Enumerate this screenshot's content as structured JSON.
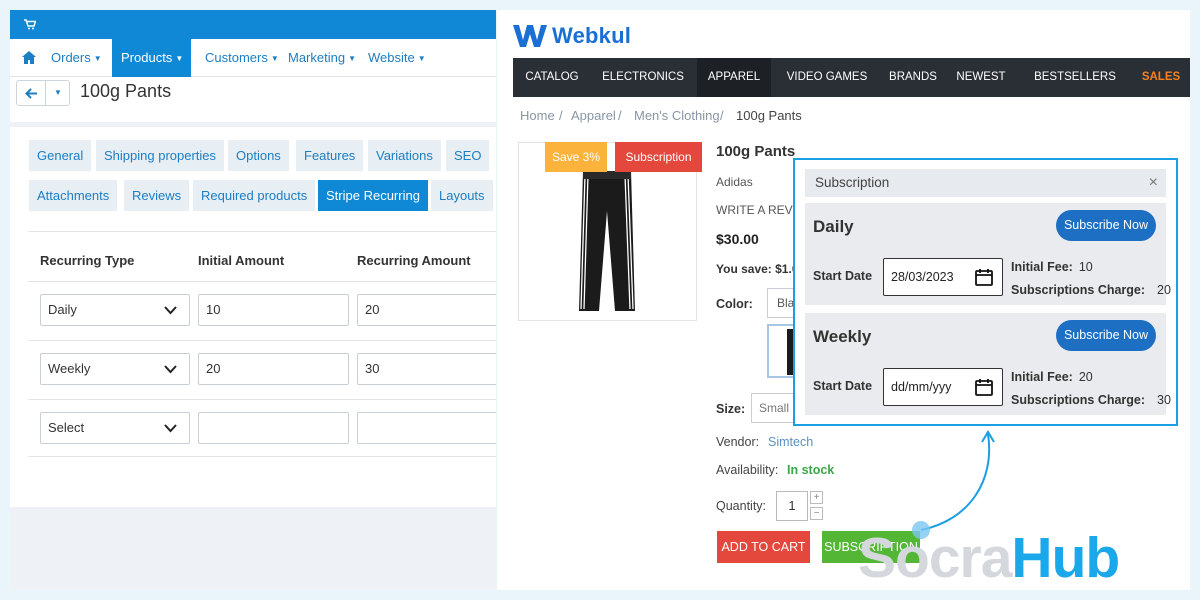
{
  "admin": {
    "menu": [
      {
        "label": "Orders",
        "active": false
      },
      {
        "label": "Products",
        "active": true
      },
      {
        "label": "Customers",
        "active": false
      },
      {
        "label": "Marketing",
        "active": false
      },
      {
        "label": "Website",
        "active": false
      }
    ],
    "page_title": "100g Pants",
    "tabs": [
      "General",
      "Shipping properties",
      "Options",
      "Features",
      "Variations",
      "SEO",
      "Attachments",
      "Reviews",
      "Required products",
      "Stripe Recurring",
      "Layouts"
    ],
    "active_tab": "Stripe Recurring",
    "table": {
      "headers": [
        "Recurring Type",
        "Initial Amount",
        "Recurring Amount"
      ],
      "rows": [
        {
          "type": "Daily",
          "initial": "10",
          "recurring": "20"
        },
        {
          "type": "Weekly",
          "initial": "20",
          "recurring": "30"
        },
        {
          "type": "Select",
          "initial": "",
          "recurring": ""
        }
      ]
    },
    "accent_color": "#0f88d5"
  },
  "store": {
    "logo": "Webkul",
    "nav": [
      "CATALOG",
      "ELECTRONICS",
      "APPAREL",
      "VIDEO GAMES",
      "BRANDS",
      "NEWEST",
      "BESTSELLERS",
      "SALES"
    ],
    "active_nav": "APPAREL",
    "breadcrumb": [
      "Home",
      "Apparel",
      "Men's Clothing",
      "100g Pants"
    ],
    "badges": {
      "save": "Save 3%",
      "subscription": "Subscription"
    },
    "product": {
      "name": "100g Pants",
      "brand": "Adidas",
      "review_link": "WRITE A REVIE",
      "price": "$30.00",
      "you_save": "You save: $1.0",
      "color_label": "Color:",
      "color_value": "Bla",
      "size_label": "Size:",
      "size_value": "Small",
      "vendor_label": "Vendor:",
      "vendor_value": "Simtech",
      "availability_label": "Availability:",
      "availability_value": "In stock",
      "quantity_label": "Quantity:",
      "quantity_value": "1",
      "qty_plus": "+",
      "qty_minus": "−"
    },
    "buttons": {
      "add_to_cart": "ADD TO CART",
      "subscription": "SUBSCRIPTION"
    }
  },
  "popup": {
    "title": "Subscription",
    "close": "×",
    "start_date_label": "Start Date",
    "initial_fee_label": "Initial Fee:",
    "charge_label": "Subscriptions Charge:",
    "subscribe_label": "Subscribe Now",
    "plans": [
      {
        "name": "Daily",
        "date": "28/03/2023",
        "initial_fee": "10",
        "charge": "20"
      },
      {
        "name": "Weekly",
        "date": "dd/mm/yyy",
        "initial_fee": "20",
        "charge": "30"
      }
    ],
    "border_color": "#1a9fe3",
    "button_color": "#1d6fc4"
  },
  "watermark": {
    "part1": "Socra",
    "part2": "Hub"
  }
}
